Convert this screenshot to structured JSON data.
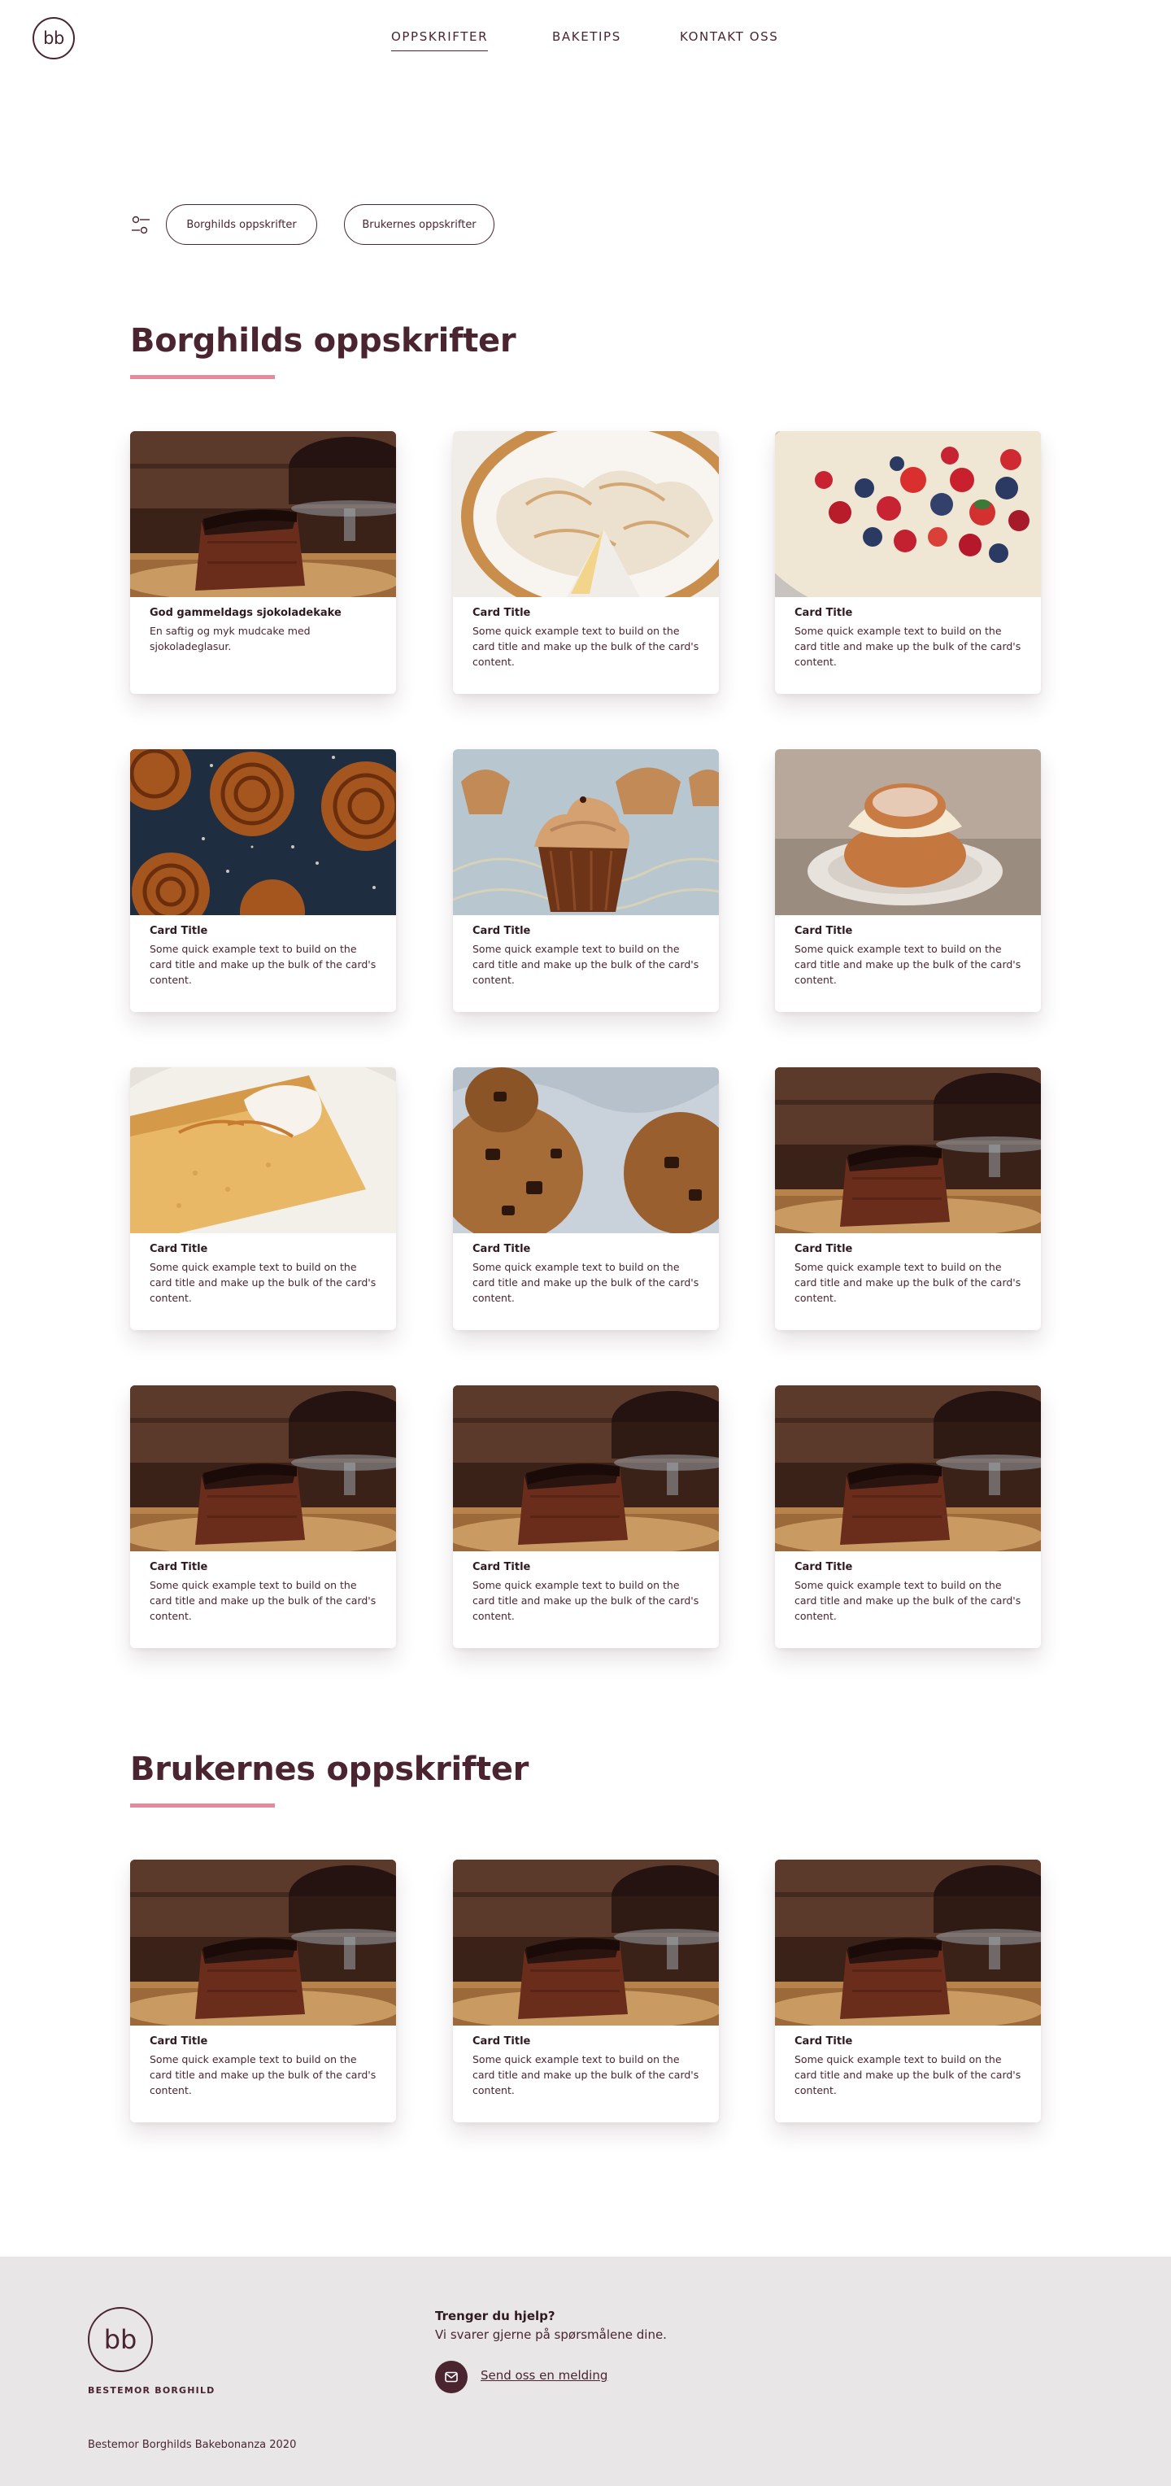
{
  "header": {
    "logo_text": "bb",
    "nav": [
      {
        "label": "OPPSKRIFTER",
        "active": true
      },
      {
        "label": "BAKETIPS",
        "active": false
      },
      {
        "label": "KONTAKT OSS",
        "active": false
      }
    ]
  },
  "filters": {
    "icon": "sliders-icon",
    "pills": [
      "Borghilds oppskrifter",
      "Brukernes oppskrifter"
    ]
  },
  "sections": [
    {
      "title": "Borghilds oppskrifter",
      "cards": [
        {
          "image": "chocolate-cake",
          "title": "God gammeldags sjokoladekake",
          "text": "En saftig og myk mudcake med sjokoladeglasur."
        },
        {
          "image": "meringue-pie",
          "title": "Card Title",
          "text": "Some quick example text to build on the card title and make up the bulk of the card's content."
        },
        {
          "image": "berry-cake",
          "title": "Card Title",
          "text": "Some quick example text to build on the card title and make up the bulk of the card's content."
        },
        {
          "image": "cinnamon-buns",
          "title": "Card Title",
          "text": "Some quick example text to build on the card title and make up the bulk of the card's content."
        },
        {
          "image": "cupcakes",
          "title": "Card Title",
          "text": "Some quick example text to build on the card title and make up the bulk of the card's content."
        },
        {
          "image": "cream-bun",
          "title": "Card Title",
          "text": "Some quick example text to build on the card title and make up the bulk of the card's content."
        },
        {
          "image": "sponge-cake-slice",
          "title": "Card Title",
          "text": "Some quick example text to build on the card title and make up the bulk of the card's content."
        },
        {
          "image": "cookies",
          "title": "Card Title",
          "text": "Some quick example text to build on the card title and make up the bulk of the card's content."
        },
        {
          "image": "chocolate-cake",
          "title": "Card Title",
          "text": "Some quick example text to build on the card title and make up the bulk of the card's content."
        },
        {
          "image": "chocolate-cake",
          "title": "Card Title",
          "text": "Some quick example text to build on the card title and make up the bulk of the card's content."
        },
        {
          "image": "chocolate-cake",
          "title": "Card Title",
          "text": "Some quick example text to build on the card title and make up the bulk of the card's content."
        },
        {
          "image": "chocolate-cake",
          "title": "Card Title",
          "text": "Some quick example text to build on the card title and make up the bulk of the card's content."
        }
      ]
    },
    {
      "title": "Brukernes oppskrifter",
      "cards": [
        {
          "image": "chocolate-cake",
          "title": "Card Title",
          "text": "Some quick example text to build on the card title and make up the bulk of the card's content."
        },
        {
          "image": "chocolate-cake",
          "title": "Card Title",
          "text": "Some quick example text to build on the card title and make up the bulk of the card's content."
        },
        {
          "image": "chocolate-cake",
          "title": "Card Title",
          "text": "Some quick example text to build on the card title and make up the bulk of the card's content."
        }
      ]
    }
  ],
  "footer": {
    "logo_text": "bb",
    "brand": "BESTEMOR BORGHILD",
    "help_title": "Trenger du hjelp?",
    "help_text": "Vi svarer gjerne på spørsmålene dine.",
    "mail_icon": "envelope-icon",
    "mail_link": "Send oss en melding",
    "copyright": "Bestemor Borghilds Bakebonanza 2020"
  },
  "colors": {
    "primary": "#4a2530",
    "accent": "#e8899b",
    "footer_bg": "#e8e6e6",
    "card_bg": "#ffffff"
  }
}
